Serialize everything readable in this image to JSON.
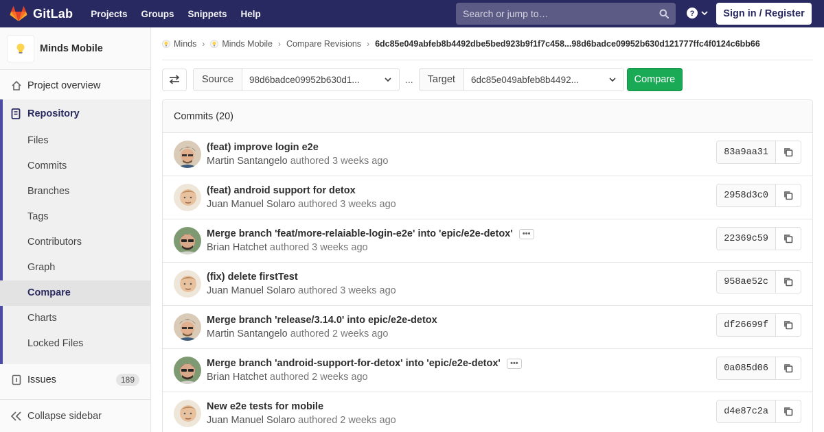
{
  "navbar": {
    "brand": "GitLab",
    "links": [
      "Projects",
      "Groups",
      "Snippets",
      "Help"
    ],
    "search_placeholder": "Search or jump to…",
    "signin_label": "Sign in / Register"
  },
  "sidebar": {
    "project_name": "Minds Mobile",
    "overview_label": "Project overview",
    "repository_label": "Repository",
    "repo_items": [
      "Files",
      "Commits",
      "Branches",
      "Tags",
      "Contributors",
      "Graph",
      "Compare",
      "Charts",
      "Locked Files"
    ],
    "active_item": "Compare",
    "issues_label": "Issues",
    "issues_count": "189",
    "collapse_label": "Collapse sidebar"
  },
  "breadcrumb": {
    "items": [
      "Minds",
      "Minds Mobile",
      "Compare Revisions"
    ],
    "current": "6dc85e049abfeb8b4492dbe5bed923b9f1f7c458...98d6badce09952b630d121777ffc4f0124c6bb66"
  },
  "compare": {
    "source_label": "Source",
    "source_value": "98d6badce09952b630d1...",
    "ellipsis": "...",
    "target_label": "Target",
    "target_value": "6dc85e049abfeb8b4492...",
    "compare_button": "Compare"
  },
  "commits": {
    "header": "Commits (20)",
    "authored_word": "authored",
    "rows": [
      {
        "title": "(feat) improve login e2e",
        "author": "Martin Santangelo",
        "time": "3 weeks ago",
        "sha": "83a9aa31",
        "has_more": false,
        "avatar": "martin"
      },
      {
        "title": "(feat) android support for detox",
        "author": "Juan Manuel Solaro",
        "time": "3 weeks ago",
        "sha": "2958d3c0",
        "has_more": false,
        "avatar": "juan"
      },
      {
        "title": "Merge branch 'feat/more-relaiable-login-e2e' into 'epic/e2e-detox'",
        "author": "Brian Hatchet",
        "time": "3 weeks ago",
        "sha": "22369c59",
        "has_more": true,
        "avatar": "brian"
      },
      {
        "title": "(fix) delete firstTest",
        "author": "Juan Manuel Solaro",
        "time": "3 weeks ago",
        "sha": "958ae52c",
        "has_more": false,
        "avatar": "juan"
      },
      {
        "title": "Merge branch 'release/3.14.0' into epic/e2e-detox",
        "author": "Martin Santangelo",
        "time": "2 weeks ago",
        "sha": "df26699f",
        "has_more": false,
        "avatar": "martin"
      },
      {
        "title": "Merge branch 'android-support-for-detox' into 'epic/e2e-detox'",
        "author": "Brian Hatchet",
        "time": "2 weeks ago",
        "sha": "0a085d06",
        "has_more": true,
        "avatar": "brian"
      },
      {
        "title": "New e2e tests for mobile",
        "author": "Juan Manuel Solaro",
        "time": "2 weeks ago",
        "sha": "d4e87c2a",
        "has_more": false,
        "avatar": "juan"
      }
    ]
  },
  "colors": {
    "navbar": "#292961",
    "accent": "#4b4ba3",
    "compare_green": "#1aaa55"
  },
  "icons": [
    "gitlab-logo-icon",
    "search-icon",
    "help-icon",
    "chevron-down-icon",
    "home-icon",
    "repository-icon",
    "issues-icon",
    "collapse-icon",
    "swap-icon",
    "copy-icon",
    "lightbulb-icon"
  ]
}
